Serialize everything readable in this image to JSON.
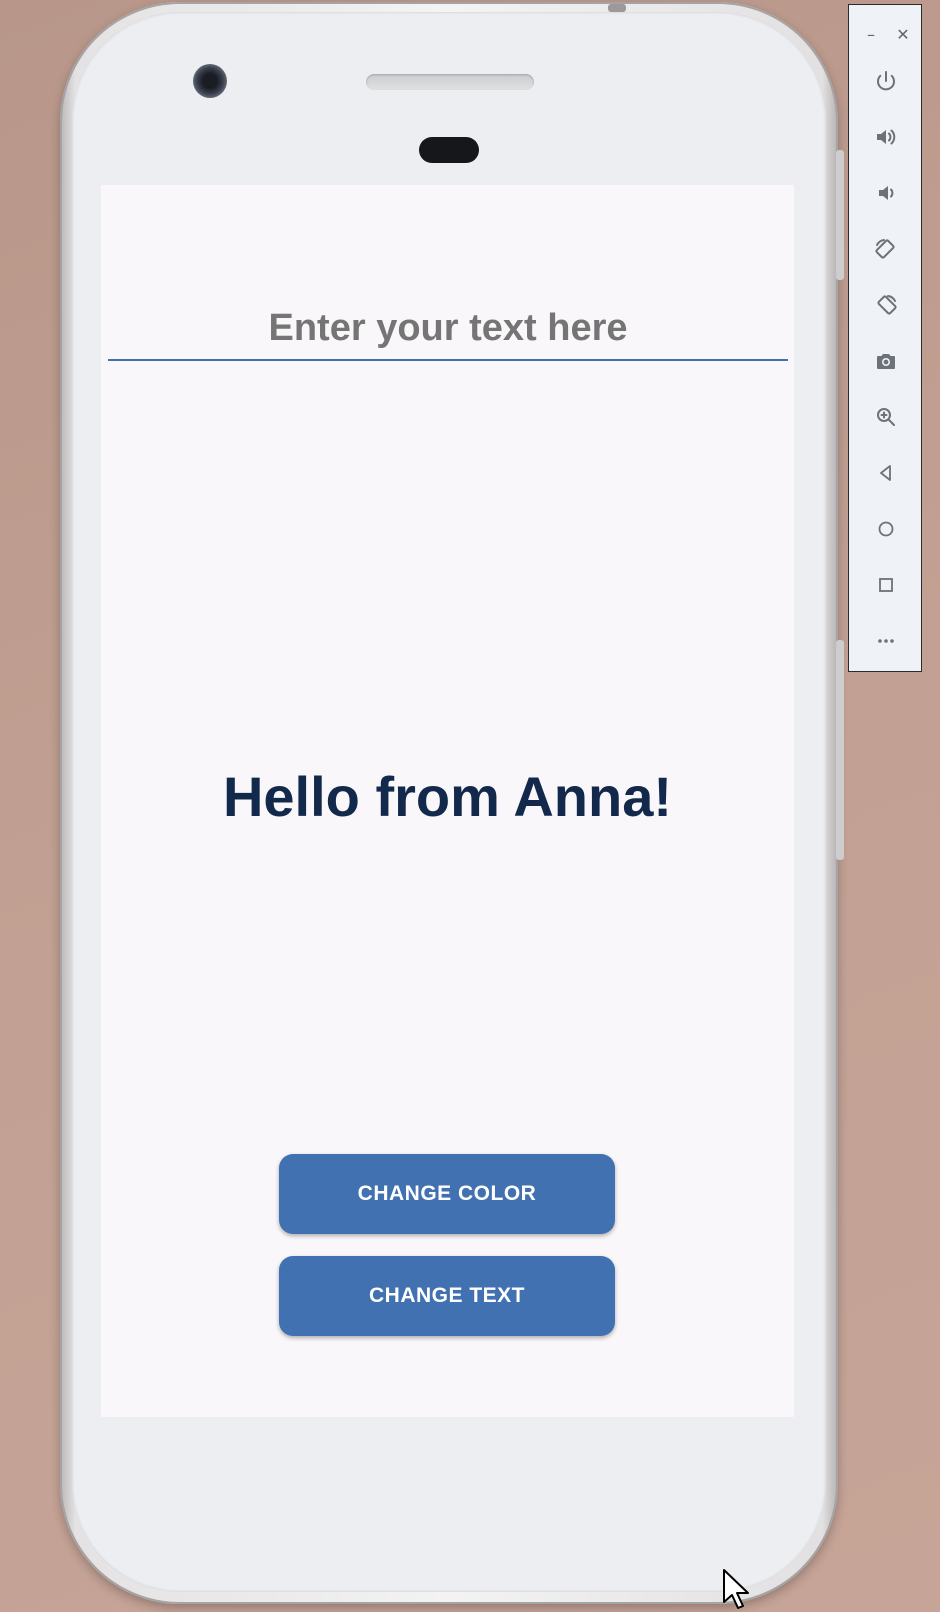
{
  "emulator": {
    "window_controls": {
      "minimize": "–",
      "close": "✕"
    },
    "toolbar_items": [
      {
        "name": "power-icon"
      },
      {
        "name": "volume-up-icon"
      },
      {
        "name": "volume-down-icon"
      },
      {
        "name": "rotate-left-icon"
      },
      {
        "name": "rotate-right-icon"
      },
      {
        "name": "camera-icon"
      },
      {
        "name": "zoom-icon"
      },
      {
        "name": "back-icon"
      },
      {
        "name": "home-icon"
      },
      {
        "name": "overview-icon"
      },
      {
        "name": "more-icon"
      }
    ]
  },
  "app": {
    "input": {
      "placeholder": "Enter your text here",
      "value": ""
    },
    "greeting_text": "Hello from Anna!",
    "buttons": {
      "change_color": "CHANGE COLOR",
      "change_text": "CHANGE TEXT"
    }
  },
  "colors": {
    "accent": "#4171b0",
    "greeting": "#13294b",
    "screen_background": "#f9f7f9",
    "desktop_background": "#c2a093"
  }
}
